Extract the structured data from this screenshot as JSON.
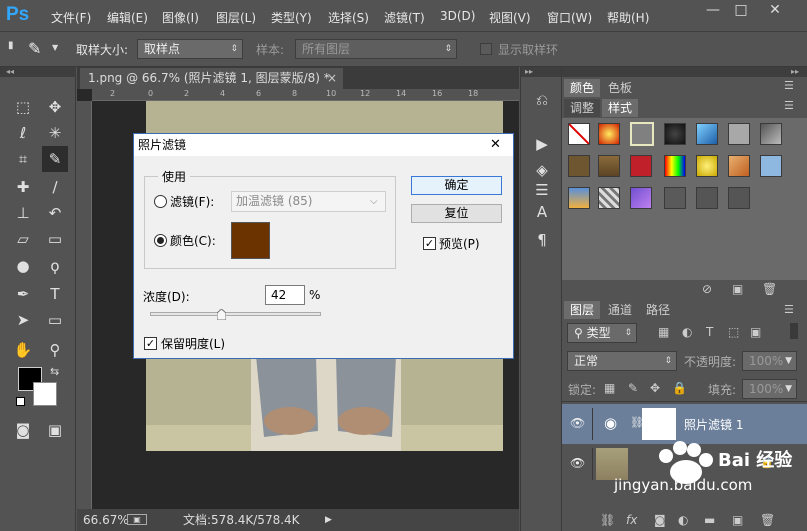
{
  "app": {
    "logo": "Ps"
  },
  "menubar": {
    "items": [
      "文件(F)",
      "编辑(E)",
      "图像(I)",
      "图层(L)",
      "类型(Y)",
      "选择(S)",
      "滤镜(T)",
      "3D(D)",
      "视图(V)",
      "窗口(W)",
      "帮助(H)"
    ],
    "minimize": "—",
    "restore": "□",
    "close": "✕"
  },
  "options": {
    "sample_size_label": "取样大小:",
    "sample_size_value": "取样点",
    "sample_label": "样本:",
    "sample_value": "所有图层",
    "show_ring_label": "显示取样环"
  },
  "document": {
    "tab_title": "1.png @ 66.7% (照片滤镜 1, 图层蒙版/8) *",
    "tab_close": "×",
    "ruler_ticks": [
      "2",
      "0",
      "2",
      "4",
      "6",
      "8",
      "10",
      "12",
      "14",
      "16",
      "18"
    ]
  },
  "status": {
    "zoom": "66.67%",
    "doc_info": "文档:578.4K/578.4K",
    "arrow": "▶"
  },
  "panels": {
    "top_tabs": [
      "颜色",
      "色板"
    ],
    "style_tabs": [
      "调整",
      "样式"
    ],
    "layer_tabs": [
      "图层",
      "通道",
      "路径"
    ],
    "filter_kind": "类型",
    "blend_mode": "正常",
    "opacity_label": "不透明度:",
    "opacity_value": "100%",
    "lock_label": "锁定:",
    "fill_label": "填充:",
    "fill_value": "100%"
  },
  "layers": [
    {
      "name": "照片滤镜 1",
      "selected": true
    },
    {
      "name": "",
      "selected": false
    }
  ],
  "dialog": {
    "title": "照片滤镜",
    "close": "✕",
    "group_label": "使用",
    "filter_label": "滤镜(F):",
    "filter_value": "加温滤镜 (85)",
    "color_label": "颜色(C):",
    "color_swatch": "#6a3300",
    "ok": "确定",
    "reset": "复位",
    "preview_label": "预览(P)",
    "density_label": "浓度(D):",
    "density_value": "42",
    "density_unit": "%",
    "density_fraction": 0.42,
    "preserve_label": "保留明度(L)"
  },
  "watermark": {
    "brand": "Bai 经验",
    "url": "jingyan.baidu.com"
  }
}
